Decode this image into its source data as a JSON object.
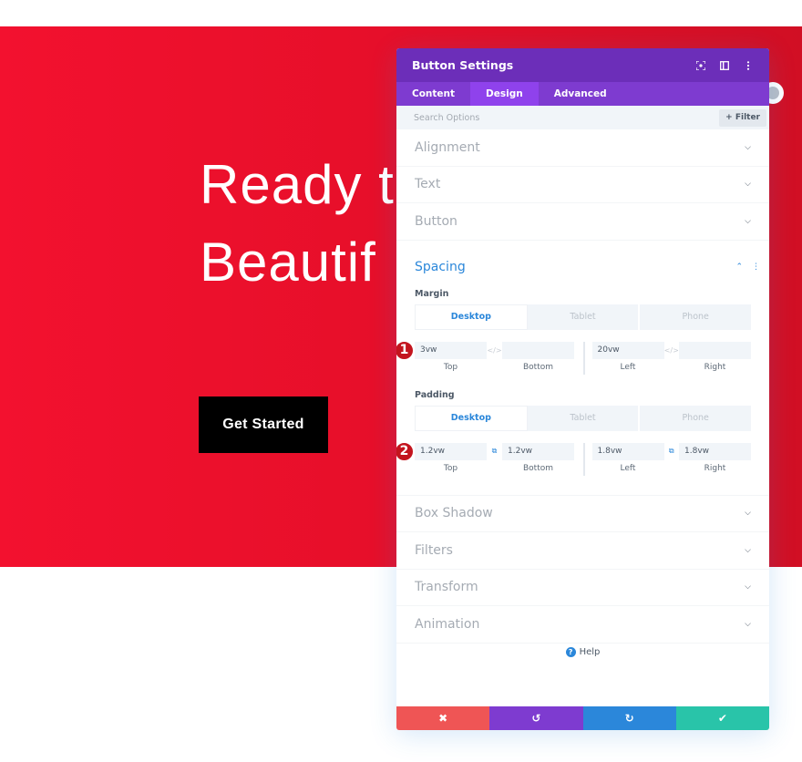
{
  "hero": {
    "title_line1": "Ready t",
    "title_line2": "Beautif",
    "button_label": "Get Started",
    "bg_color": "#e70f2a"
  },
  "modal": {
    "title": "Button Settings",
    "header_icons": [
      "focus-icon",
      "split-view-icon",
      "more-vertical-icon"
    ],
    "tabs": [
      {
        "label": "Content",
        "active": false
      },
      {
        "label": "Design",
        "active": true
      },
      {
        "label": "Advanced",
        "active": false
      }
    ],
    "search_placeholder": "Search Options",
    "filter_label": "+ Filter",
    "sections_top": [
      {
        "label": "Alignment"
      },
      {
        "label": "Text"
      },
      {
        "label": "Button"
      }
    ],
    "spacing": {
      "label": "Spacing",
      "margin": {
        "label": "Margin",
        "devices": [
          "Desktop",
          "Tablet",
          "Phone"
        ],
        "active_device": "Desktop",
        "badge": "1",
        "fields": [
          {
            "caption": "Top",
            "value": "3vw"
          },
          {
            "caption": "Bottom",
            "value": ""
          },
          {
            "caption": "Left",
            "value": "20vw"
          },
          {
            "caption": "Right",
            "value": ""
          }
        ],
        "linked": false
      },
      "padding": {
        "label": "Padding",
        "devices": [
          "Desktop",
          "Tablet",
          "Phone"
        ],
        "active_device": "Desktop",
        "badge": "2",
        "fields": [
          {
            "caption": "Top",
            "value": "1.2vw"
          },
          {
            "caption": "Bottom",
            "value": "1.2vw"
          },
          {
            "caption": "Left",
            "value": "1.8vw"
          },
          {
            "caption": "Right",
            "value": "1.8vw"
          }
        ],
        "linked": true
      }
    },
    "sections_bottom": [
      {
        "label": "Box Shadow"
      },
      {
        "label": "Filters"
      },
      {
        "label": "Transform"
      },
      {
        "label": "Animation"
      }
    ],
    "help_label": "Help",
    "footer": [
      {
        "name": "cancel",
        "glyph": "✖",
        "color": "#ef5555"
      },
      {
        "name": "undo",
        "glyph": "↺",
        "color": "#7e3bd0"
      },
      {
        "name": "redo",
        "glyph": "↻",
        "color": "#2b87da"
      },
      {
        "name": "save",
        "glyph": "✔",
        "color": "#29c4a9"
      }
    ],
    "colors": {
      "header": "#6c2eb9",
      "tabs": "#7e3bd0",
      "active_tab": "#8f42ec",
      "accent": "#2b87da"
    }
  }
}
